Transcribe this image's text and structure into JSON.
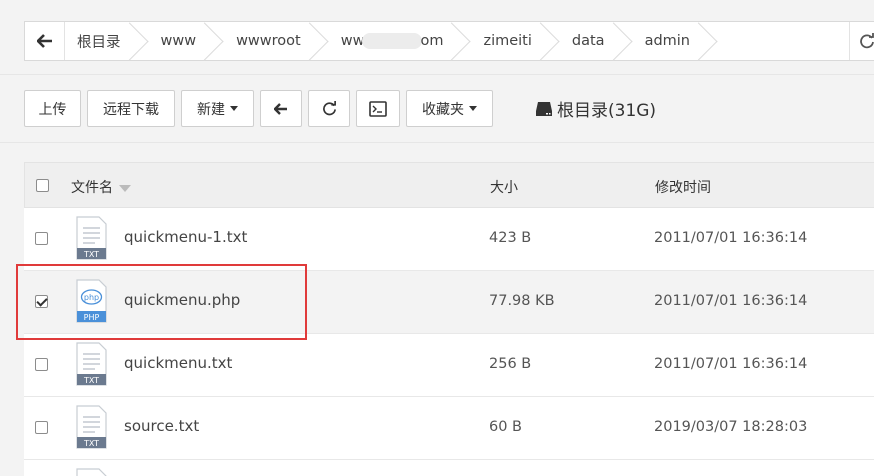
{
  "breadcrumb": {
    "items": [
      "根目录",
      "www",
      "wwwroot",
      "ww",
      "om",
      "zimeiti",
      "data",
      "admin"
    ]
  },
  "toolbar": {
    "upload": "上传",
    "remote_download": "远程下载",
    "new": "新建",
    "favorites": "收藏夹",
    "root_info": "根目录(31G)"
  },
  "table": {
    "headers": {
      "name": "文件名",
      "size": "大小",
      "modified": "修改时间"
    },
    "rows": [
      {
        "name": "quickmenu-1.txt",
        "size": "423 B",
        "modified": "2011/07/01 16:36:14",
        "type": "TXT",
        "checked": false
      },
      {
        "name": "quickmenu.php",
        "size": "77.98 KB",
        "modified": "2011/07/01 16:36:14",
        "type": "PHP",
        "checked": true
      },
      {
        "name": "quickmenu.txt",
        "size": "256 B",
        "modified": "2011/07/01 16:36:14",
        "type": "TXT",
        "checked": false
      },
      {
        "name": "source.txt",
        "size": "60 B",
        "modified": "2019/03/07 18:28:03",
        "type": "TXT",
        "checked": false
      }
    ]
  },
  "colors": {
    "highlight": "#e03a3a",
    "php_icon": "#4a90d9",
    "txt_icon": "#6b7a8f"
  }
}
